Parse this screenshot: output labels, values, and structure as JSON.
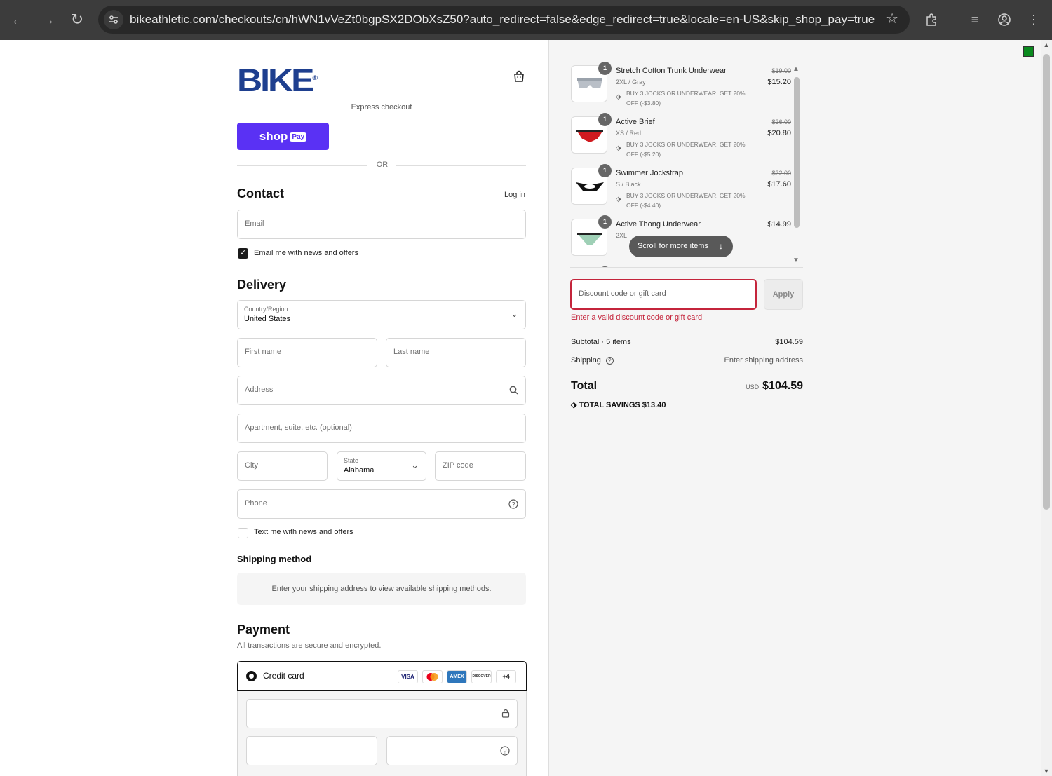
{
  "browser": {
    "url": "bikeathletic.com/checkouts/cn/hWN1vVeZt0bgpSX2DObXsZ50?auto_redirect=false&edge_redirect=true&locale=en-US&skip_shop_pay=true"
  },
  "header": {
    "logo": "BIKE",
    "logo_mark": "®"
  },
  "express": {
    "label": "Express checkout",
    "shop_word": "shop",
    "shop_pay": "Pay",
    "or": "OR"
  },
  "contact": {
    "title": "Contact",
    "login": "Log in",
    "email_placeholder": "Email",
    "newsletter_label": "Email me with news and offers",
    "newsletter_checked": true
  },
  "delivery": {
    "title": "Delivery",
    "country_label": "Country/Region",
    "country_value": "United States",
    "first_name": "First name",
    "last_name": "Last name",
    "address": "Address",
    "apartment": "Apartment, suite, etc. (optional)",
    "city": "City",
    "state_label": "State",
    "state_value": "Alabama",
    "zip": "ZIP code",
    "phone": "Phone",
    "sms_label": "Text me with news and offers",
    "sms_checked": false
  },
  "shipping_method": {
    "title": "Shipping method",
    "message": "Enter your shipping address to view available shipping methods."
  },
  "payment": {
    "title": "Payment",
    "subtitle": "All transactions are secure and encrypted.",
    "method": "Credit card",
    "brands": [
      "VISA",
      "MC",
      "AMEX",
      "DISCOVER",
      "+4"
    ]
  },
  "cart": {
    "items": [
      {
        "qty": "1",
        "name": "Stretch Cotton Trunk Underwear",
        "variant": "2XL / Gray",
        "promo": "BUY 3 JOCKS OR UNDERWEAR, GET 20% OFF (-$3.80)",
        "old_price": "$19.00",
        "price": "$15.20"
      },
      {
        "qty": "1",
        "name": "Active Brief",
        "variant": "XS / Red",
        "promo": "BUY 3 JOCKS OR UNDERWEAR, GET 20% OFF (-$5.20)",
        "old_price": "$26.00",
        "price": "$20.80"
      },
      {
        "qty": "1",
        "name": "Swimmer Jockstrap",
        "variant": "S / Black",
        "promo": "BUY 3 JOCKS OR UNDERWEAR, GET 20% OFF (-$4.40)",
        "old_price": "$22.00",
        "price": "$17.60"
      },
      {
        "qty": "1",
        "name": "Active Thong Underwear",
        "variant": "2XL",
        "price": "$14.99"
      }
    ],
    "scroll_hint": "Scroll for more items",
    "discount_placeholder": "Discount code or gift card",
    "apply": "Apply",
    "discount_error": "Enter a valid discount code or gift card",
    "subtotal_label": "Subtotal · 5 items",
    "subtotal_value": "$104.59",
    "shipping_label": "Shipping",
    "shipping_value": "Enter shipping address",
    "total_label": "Total",
    "currency": "USD",
    "total_value": "$104.59",
    "savings_label": "TOTAL SAVINGS",
    "savings_value": "$13.40"
  },
  "colors": {
    "brand": "#1e3f8f",
    "shop_pay": "#5a31f4",
    "error": "#c4243b"
  }
}
